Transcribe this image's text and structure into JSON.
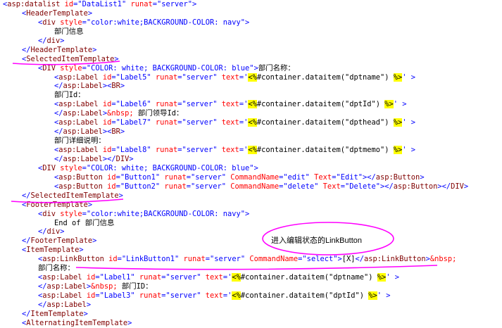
{
  "code_lines": [
    {
      "indent": 0,
      "tokens": [
        [
          "<",
          "blue"
        ],
        [
          "asp:datalist",
          "maroon"
        ],
        [
          " id",
          "red"
        ],
        [
          "=\"DataList1\"",
          "blue"
        ],
        [
          " runat",
          "red"
        ],
        [
          "=\"server\">",
          "blue"
        ]
      ]
    },
    {
      "indent": 1,
      "tokens": [
        [
          "<",
          "blue"
        ],
        [
          "HeaderTemplate",
          "maroon"
        ],
        [
          ">",
          "blue"
        ]
      ]
    },
    {
      "indent": 2,
      "tokens": [
        [
          "<",
          "blue"
        ],
        [
          "div",
          "maroon"
        ],
        [
          " style",
          "red"
        ],
        [
          "=\"color:white;BACKGROUND-COLOR: navy\">",
          "blue"
        ]
      ]
    },
    {
      "indent": 3,
      "tokens": [
        [
          "部门信息",
          "black"
        ]
      ]
    },
    {
      "indent": 2,
      "tokens": [
        [
          "</",
          "blue"
        ],
        [
          "div",
          "maroon"
        ],
        [
          ">",
          "blue"
        ]
      ]
    },
    {
      "indent": 1,
      "tokens": [
        [
          "</",
          "blue"
        ],
        [
          "HeaderTemplate",
          "maroon"
        ],
        [
          ">",
          "blue"
        ]
      ]
    },
    {
      "indent": 1,
      "tokens": [
        [
          "<",
          "blue"
        ],
        [
          "SelectedItemTemplate",
          "maroon"
        ],
        [
          ">",
          "blue"
        ]
      ]
    },
    {
      "indent": 2,
      "tokens": [
        [
          "<",
          "blue"
        ],
        [
          "DIV",
          "maroon"
        ],
        [
          " style",
          "red"
        ],
        [
          "=\"COLOR: white; BACKGROUND-COLOR: blue\">",
          "blue"
        ],
        [
          "部门名称：",
          "black"
        ]
      ]
    },
    {
      "indent": 3,
      "tokens": [
        [
          "<",
          "blue"
        ],
        [
          "asp:Label",
          "maroon"
        ],
        [
          " id",
          "red"
        ],
        [
          "=\"Label5\"",
          "blue"
        ],
        [
          " runat",
          "red"
        ],
        [
          "=\"server\"",
          "blue"
        ],
        [
          " text",
          "red"
        ],
        [
          "='",
          "blue"
        ],
        [
          "<%",
          "hl"
        ],
        [
          "#container.dataitem(\"dptname\") ",
          "black"
        ],
        [
          "%>",
          "hl"
        ],
        [
          "' >",
          "blue"
        ]
      ]
    },
    {
      "indent": 3,
      "tokens": [
        [
          "</",
          "blue"
        ],
        [
          "asp:Label",
          "maroon"
        ],
        [
          "><",
          "blue"
        ],
        [
          "BR",
          "maroon"
        ],
        [
          ">",
          "blue"
        ]
      ]
    },
    {
      "indent": 3,
      "tokens": [
        [
          "部门Id：",
          "black"
        ]
      ]
    },
    {
      "indent": 3,
      "tokens": [
        [
          "<",
          "blue"
        ],
        [
          "asp:Label",
          "maroon"
        ],
        [
          " id",
          "red"
        ],
        [
          "=\"Label6\"",
          "blue"
        ],
        [
          " runat",
          "red"
        ],
        [
          "=\"server\"",
          "blue"
        ],
        [
          " text",
          "red"
        ],
        [
          "='",
          "blue"
        ],
        [
          "<%",
          "hl"
        ],
        [
          "#container.dataitem(\"dptId\") ",
          "black"
        ],
        [
          "%>",
          "hl"
        ],
        [
          "' >",
          "blue"
        ]
      ]
    },
    {
      "indent": 3,
      "tokens": [
        [
          "</",
          "blue"
        ],
        [
          "asp:Label",
          "maroon"
        ],
        [
          ">",
          "blue"
        ],
        [
          "&nbsp;",
          "red"
        ],
        [
          " 部门领导Id：",
          "black"
        ]
      ]
    },
    {
      "indent": 3,
      "tokens": [
        [
          "<",
          "blue"
        ],
        [
          "asp:Label",
          "maroon"
        ],
        [
          " id",
          "red"
        ],
        [
          "=\"Label7\"",
          "blue"
        ],
        [
          " runat",
          "red"
        ],
        [
          "=\"server\"",
          "blue"
        ],
        [
          " text",
          "red"
        ],
        [
          "='",
          "blue"
        ],
        [
          "<%",
          "hl"
        ],
        [
          "#container.dataitem(\"dpthead\") ",
          "black"
        ],
        [
          "%>",
          "hl"
        ],
        [
          "' >",
          "blue"
        ]
      ]
    },
    {
      "indent": 3,
      "tokens": [
        [
          "</",
          "blue"
        ],
        [
          "asp:Label",
          "maroon"
        ],
        [
          "><",
          "blue"
        ],
        [
          "BR",
          "maroon"
        ],
        [
          ">",
          "blue"
        ]
      ]
    },
    {
      "indent": 3,
      "tokens": [
        [
          "部门详细说明：",
          "black"
        ]
      ]
    },
    {
      "indent": 3,
      "tokens": [
        [
          "<",
          "blue"
        ],
        [
          "asp:Label",
          "maroon"
        ],
        [
          " id",
          "red"
        ],
        [
          "=\"Label8\"",
          "blue"
        ],
        [
          " runat",
          "red"
        ],
        [
          "=\"server\"",
          "blue"
        ],
        [
          " text",
          "red"
        ],
        [
          "='",
          "blue"
        ],
        [
          "<%",
          "hl"
        ],
        [
          "#container.dataitem(\"dptmemo\") ",
          "black"
        ],
        [
          "%>",
          "hl"
        ],
        [
          "' >",
          "blue"
        ]
      ]
    },
    {
      "indent": 3,
      "tokens": [
        [
          "</",
          "blue"
        ],
        [
          "asp:Label",
          "maroon"
        ],
        [
          "></",
          "blue"
        ],
        [
          "DIV",
          "maroon"
        ],
        [
          ">",
          "blue"
        ]
      ]
    },
    {
      "indent": 2,
      "tokens": [
        [
          "<",
          "blue"
        ],
        [
          "DIV",
          "maroon"
        ],
        [
          " style",
          "red"
        ],
        [
          "=\"COLOR: white; BACKGROUND-COLOR: blue\">",
          "blue"
        ]
      ]
    },
    {
      "indent": 3,
      "tokens": [
        [
          "<",
          "blue"
        ],
        [
          "asp:Button",
          "maroon"
        ],
        [
          " id",
          "red"
        ],
        [
          "=\"Button1\"",
          "blue"
        ],
        [
          " runat",
          "red"
        ],
        [
          "=\"server\"",
          "blue"
        ],
        [
          " CommandName",
          "red"
        ],
        [
          "=\"edit\"",
          "blue"
        ],
        [
          " Text",
          "red"
        ],
        [
          "=\"Edit\"></",
          "blue"
        ],
        [
          "asp:Button",
          "maroon"
        ],
        [
          ">",
          "blue"
        ]
      ]
    },
    {
      "indent": 3,
      "tokens": [
        [
          "<",
          "blue"
        ],
        [
          "asp:Button",
          "maroon"
        ],
        [
          " id",
          "red"
        ],
        [
          "=\"Button2\"",
          "blue"
        ],
        [
          " runat",
          "red"
        ],
        [
          "=\"server\"",
          "blue"
        ],
        [
          " CommandName",
          "red"
        ],
        [
          "=\"delete\"",
          "blue"
        ],
        [
          " Text",
          "red"
        ],
        [
          "=\"Delete\"></",
          "blue"
        ],
        [
          "asp:Button",
          "maroon"
        ],
        [
          "></",
          "blue"
        ],
        [
          "DIV",
          "maroon"
        ],
        [
          ">",
          "blue"
        ]
      ]
    },
    {
      "indent": 1,
      "tokens": [
        [
          "</",
          "blue"
        ],
        [
          "SelectedItemTemplate",
          "maroon"
        ],
        [
          ">",
          "blue"
        ]
      ]
    },
    {
      "indent": 1,
      "tokens": [
        [
          "<",
          "blue"
        ],
        [
          "FooterTemplate",
          "maroon"
        ],
        [
          ">",
          "blue"
        ]
      ]
    },
    {
      "indent": 2,
      "tokens": [
        [
          "<",
          "blue"
        ],
        [
          "div",
          "maroon"
        ],
        [
          " style",
          "red"
        ],
        [
          "=\"color:white;BACKGROUND-COLOR: navy\">",
          "blue"
        ]
      ]
    },
    {
      "indent": 3,
      "tokens": [
        [
          "End of 部门信息",
          "black"
        ]
      ]
    },
    {
      "indent": 2,
      "tokens": [
        [
          "</",
          "blue"
        ],
        [
          "div",
          "maroon"
        ],
        [
          ">",
          "blue"
        ]
      ]
    },
    {
      "indent": 1,
      "tokens": [
        [
          "</",
          "blue"
        ],
        [
          "FooterTemplate",
          "maroon"
        ],
        [
          ">",
          "blue"
        ]
      ]
    },
    {
      "indent": 1,
      "tokens": [
        [
          "<",
          "blue"
        ],
        [
          "ItemTemplate",
          "maroon"
        ],
        [
          ">",
          "blue"
        ]
      ]
    },
    {
      "indent": 2,
      "tokens": [
        [
          "<",
          "blue"
        ],
        [
          "asp:LinkButton",
          "maroon"
        ],
        [
          " id",
          "red"
        ],
        [
          "=\"LinkButton1\"",
          "blue"
        ],
        [
          " runat",
          "red"
        ],
        [
          "=\"server\"",
          "blue"
        ],
        [
          " CommandName",
          "red"
        ],
        [
          "=\"select\">",
          "blue"
        ],
        [
          "[X]",
          "black"
        ],
        [
          "</",
          "blue"
        ],
        [
          "asp:LinkButton",
          "maroon"
        ],
        [
          ">",
          "blue"
        ],
        [
          "&nbsp;",
          "red"
        ]
      ]
    },
    {
      "indent": 2,
      "tokens": [
        [
          "部门名称：",
          "black"
        ]
      ]
    },
    {
      "indent": 2,
      "tokens": [
        [
          "<",
          "blue"
        ],
        [
          "asp:Label",
          "maroon"
        ],
        [
          " id",
          "red"
        ],
        [
          "=\"Label1\"",
          "blue"
        ],
        [
          " runat",
          "red"
        ],
        [
          "=\"server\"",
          "blue"
        ],
        [
          " text",
          "red"
        ],
        [
          "='",
          "blue"
        ],
        [
          "<%",
          "hl"
        ],
        [
          "#container.dataitem(\"dptname\") ",
          "black"
        ],
        [
          "%>",
          "hl"
        ],
        [
          "' >",
          "blue"
        ]
      ]
    },
    {
      "indent": 2,
      "tokens": [
        [
          "</",
          "blue"
        ],
        [
          "asp:Label",
          "maroon"
        ],
        [
          ">",
          "blue"
        ],
        [
          "&nbsp;",
          "red"
        ],
        [
          " 部门ID：",
          "black"
        ]
      ]
    },
    {
      "indent": 2,
      "tokens": [
        [
          "<",
          "blue"
        ],
        [
          "asp:Label",
          "maroon"
        ],
        [
          " id",
          "red"
        ],
        [
          "=\"Label3\"",
          "blue"
        ],
        [
          " runat",
          "red"
        ],
        [
          "=\"server\"",
          "blue"
        ],
        [
          " text",
          "red"
        ],
        [
          "='",
          "blue"
        ],
        [
          "<%",
          "hl"
        ],
        [
          "#container.dataitem(\"dptId\") ",
          "black"
        ],
        [
          "%>",
          "hl"
        ],
        [
          "' >",
          "blue"
        ]
      ]
    },
    {
      "indent": 2,
      "tokens": [
        [
          "</",
          "blue"
        ],
        [
          "asp:Label",
          "maroon"
        ],
        [
          ">",
          "blue"
        ]
      ]
    },
    {
      "indent": 1,
      "tokens": [
        [
          "</",
          "blue"
        ],
        [
          "ItemTemplate",
          "maroon"
        ],
        [
          ">",
          "blue"
        ]
      ]
    },
    {
      "indent": 1,
      "tokens": [
        [
          "<",
          "blue"
        ],
        [
          "AlternatingItemTemplate",
          "maroon"
        ],
        [
          ">",
          "blue"
        ]
      ]
    }
  ],
  "annotation": {
    "text": "进入编辑状态的LinkButton",
    "color": "#ff00ff"
  },
  "colors": {
    "blue": "#0000ff",
    "maroon": "#800000",
    "red": "#ff0000",
    "highlight": "#ffff00",
    "markup": "#ff00ff"
  }
}
